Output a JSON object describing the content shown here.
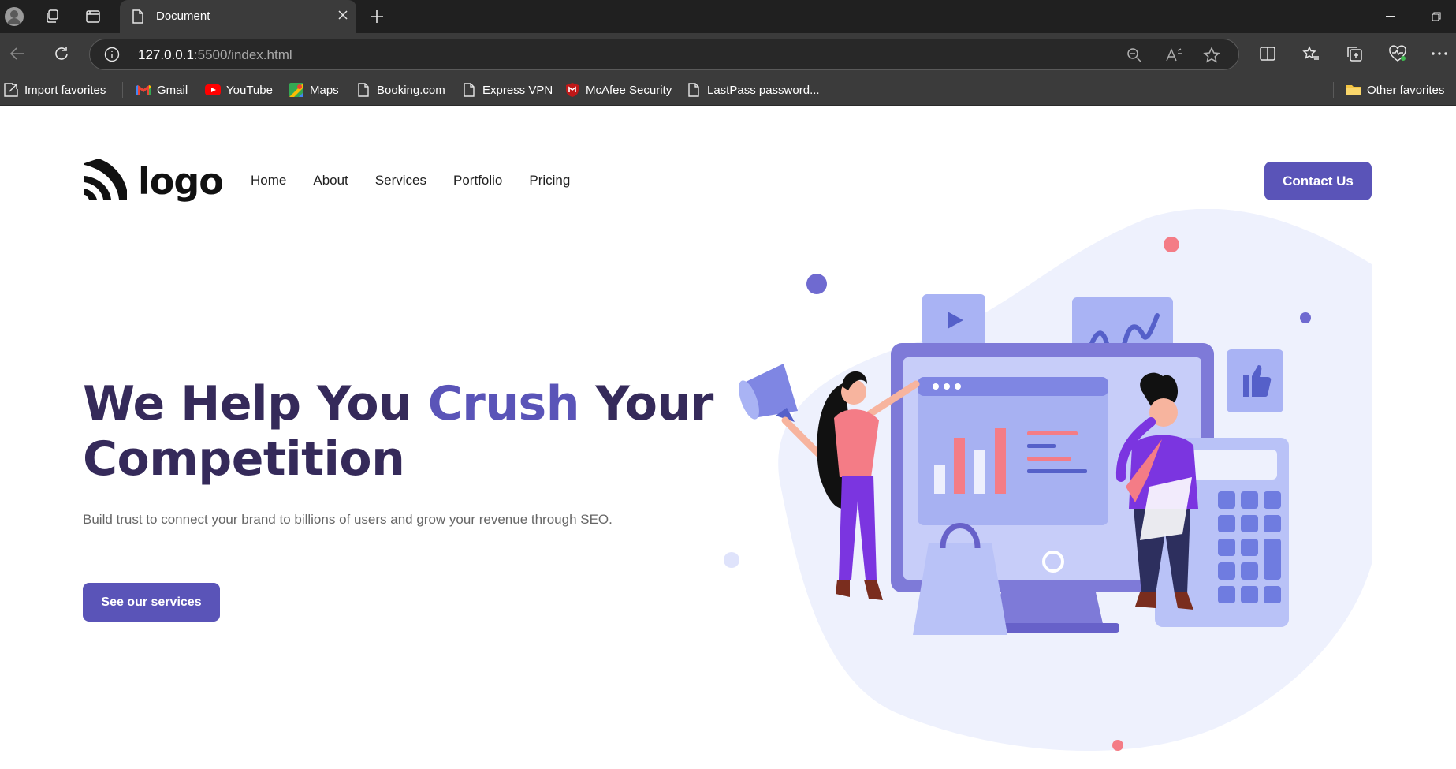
{
  "browser": {
    "tab_title": "Document",
    "url_host": "127.0.0.1",
    "url_rest": ":5500/index.html",
    "bookmarks": [
      {
        "label": "Import favorites",
        "icon": "import-icon"
      },
      {
        "label": "Gmail",
        "icon": "gmail-icon"
      },
      {
        "label": "YouTube",
        "icon": "youtube-icon"
      },
      {
        "label": "Maps",
        "icon": "maps-icon"
      },
      {
        "label": "Booking.com",
        "icon": "page-icon"
      },
      {
        "label": "Express VPN",
        "icon": "page-icon"
      },
      {
        "label": "McAfee Security",
        "icon": "mcafee-icon"
      },
      {
        "label": "LastPass password...",
        "icon": "page-icon"
      }
    ],
    "other_favorites": "Other favorites"
  },
  "site": {
    "logo_text": "logo",
    "nav": [
      "Home",
      "About",
      "Services",
      "Portfolio",
      "Pricing"
    ],
    "contact_label": "Contact Us",
    "headline_part1": "We Help You ",
    "headline_accent": "Crush",
    "headline_part2": " Your",
    "headline_line2": "Competition",
    "subtext": "Build trust to connect your brand to billions of users and grow your revenue through SEO.",
    "cta_label": "See our services"
  },
  "colors": {
    "brand": "#5a54b8",
    "heading": "#352a5a",
    "chrome_dark": "#202020",
    "chrome": "#3b3b3b"
  }
}
